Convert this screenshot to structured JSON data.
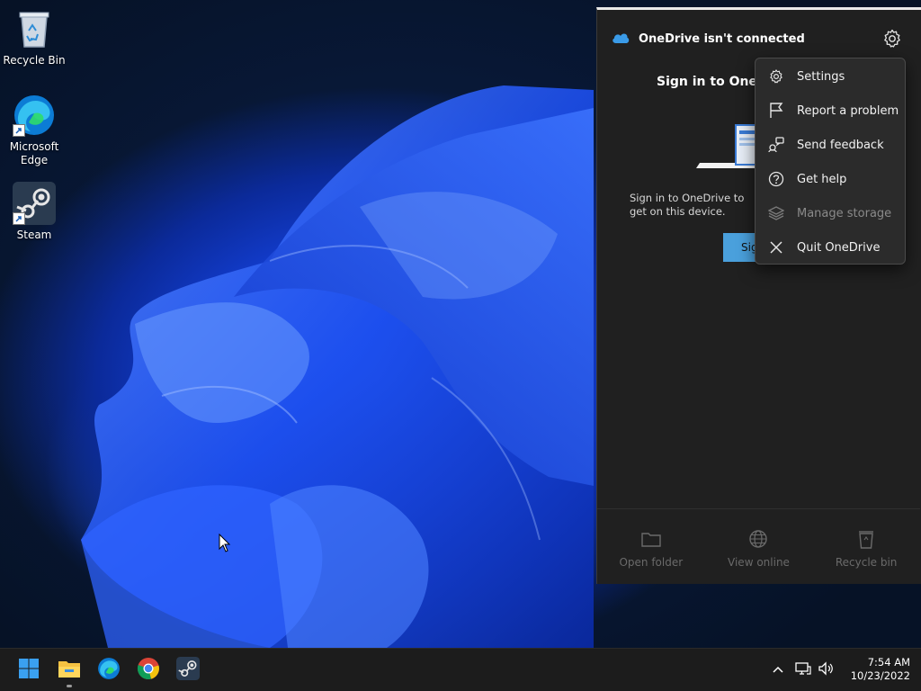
{
  "desktop": {
    "icons": [
      {
        "label": "Recycle Bin",
        "icon": "recycle-bin-icon"
      },
      {
        "label": "Microsoft Edge",
        "icon": "edge-icon"
      },
      {
        "label": "Steam",
        "icon": "steam-icon"
      }
    ]
  },
  "onedrive": {
    "title": "OneDrive isn't connected",
    "signin_title": "Sign in to OneD",
    "description": "Sign in to OneDrive to get on this device.",
    "signin_button": "Sig",
    "footer": [
      {
        "label": "Open folder",
        "icon": "folder-icon"
      },
      {
        "label": "View online",
        "icon": "globe-icon"
      },
      {
        "label": "Recycle bin",
        "icon": "recycle-bin-icon"
      }
    ]
  },
  "context_menu": {
    "items": [
      {
        "label": "Settings",
        "icon": "gear-icon",
        "enabled": true
      },
      {
        "label": "Report a problem",
        "icon": "flag-icon",
        "enabled": true
      },
      {
        "label": "Send feedback",
        "icon": "feedback-icon",
        "enabled": true
      },
      {
        "label": "Get help",
        "icon": "help-icon",
        "enabled": true
      },
      {
        "label": "Manage storage",
        "icon": "layers-icon",
        "enabled": false
      },
      {
        "label": "Quit OneDrive",
        "icon": "close-icon",
        "enabled": true
      }
    ]
  },
  "taskbar": {
    "apps": [
      "start-icon",
      "file-explorer-icon",
      "edge-icon",
      "chrome-icon",
      "steam-icon"
    ],
    "clock": {
      "time": "7:54 AM",
      "date": "10/23/2022"
    }
  },
  "colors": {
    "accent": "#4aa0dc",
    "panel_bg": "#202020",
    "menu_bg": "#2b2b2b",
    "taskbar_bg": "#1c1c1c"
  }
}
